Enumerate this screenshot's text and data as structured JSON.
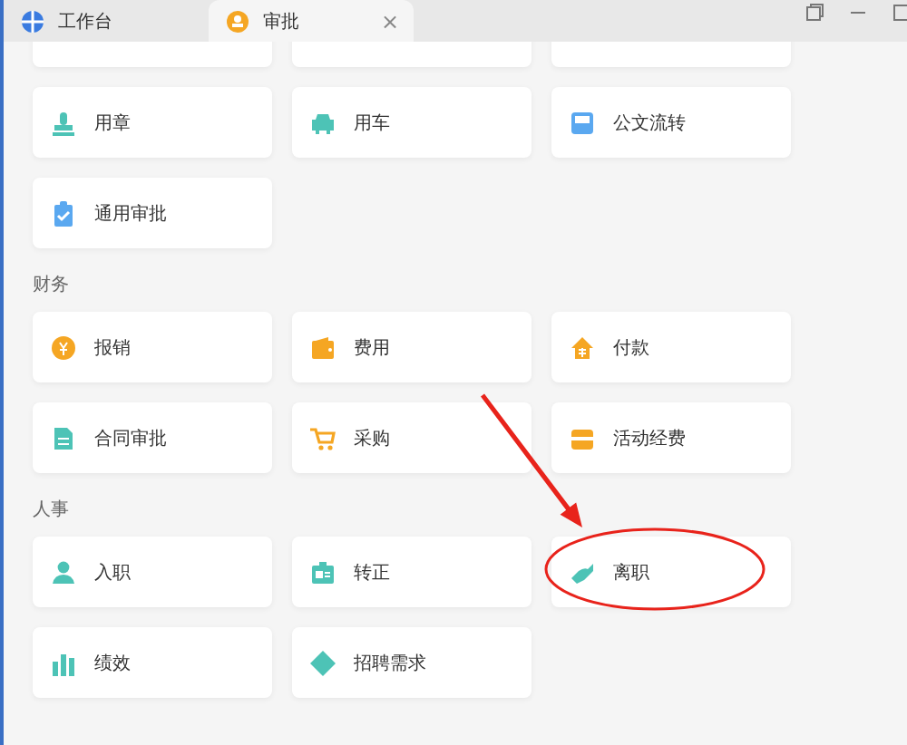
{
  "tabs": [
    {
      "label": "工作台",
      "selected": false
    },
    {
      "label": "审批",
      "selected": true,
      "close": "×"
    }
  ],
  "sections": [
    {
      "items": [
        {
          "kind": "cut"
        },
        {
          "kind": "cut"
        },
        {
          "kind": "cut"
        },
        {
          "kind": "item",
          "label": "用章"
        },
        {
          "kind": "item",
          "label": "用车"
        },
        {
          "kind": "item",
          "label": "公文流转"
        },
        {
          "kind": "item",
          "label": "通用审批"
        }
      ]
    },
    {
      "title": "财务",
      "items": [
        {
          "kind": "item",
          "label": "报销"
        },
        {
          "kind": "item",
          "label": "费用"
        },
        {
          "kind": "item",
          "label": "付款"
        },
        {
          "kind": "item",
          "label": "合同审批"
        },
        {
          "kind": "item",
          "label": "采购"
        },
        {
          "kind": "item",
          "label": "活动经费"
        }
      ]
    },
    {
      "title": "人事",
      "items": [
        {
          "kind": "item",
          "label": "入职"
        },
        {
          "kind": "item",
          "label": "转正"
        },
        {
          "kind": "item",
          "label": "离职"
        },
        {
          "kind": "item",
          "label": "绩效"
        },
        {
          "kind": "item",
          "label": "招聘需求"
        }
      ]
    }
  ],
  "annotations": [
    {
      "kind": "arrow"
    },
    {
      "kind": "ellipse"
    }
  ]
}
